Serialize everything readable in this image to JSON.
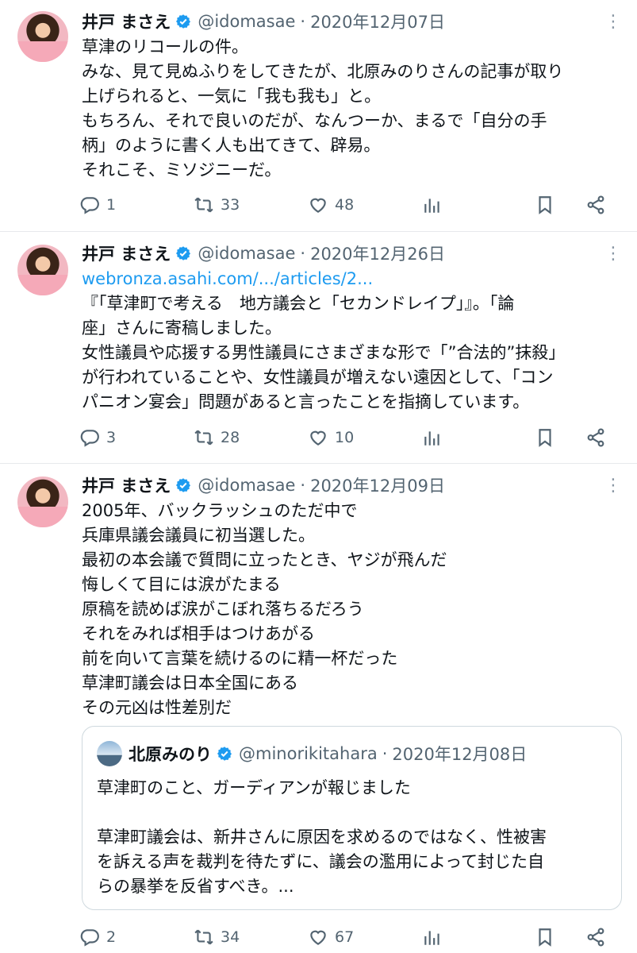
{
  "colors": {
    "accent": "#1d9bf0",
    "secondary_text": "#536471",
    "divider": "#e7e9ec"
  },
  "icons": [
    "reply-icon",
    "retweet-icon",
    "like-icon",
    "views-icon",
    "bookmark-icon",
    "share-icon",
    "verified-icon",
    "more-icon"
  ],
  "tweets": [
    {
      "name": "井戸 まさえ",
      "handle": "@idomasae",
      "separator": "·",
      "date": "2020年12月07日",
      "more": "⋮",
      "link": "",
      "lines": [
        "草津のリコールの件。",
        "みな、見て見ぬふりをしてきたが、北原みのりさんの記事が取り",
        "上げられると、一気に「我も我も」と。",
        "もちろん、それで良いのだが、なんつーか、まるで「自分の手",
        "柄」のように書く人も出てきて、辟易。",
        "それこそ、ミソジニーだ。"
      ],
      "replies": "1",
      "retweets": "33",
      "likes": "48"
    },
    {
      "name": "井戸 まさえ",
      "handle": "@idomasae",
      "separator": "·",
      "date": "2020年12月26日",
      "more": "⋮",
      "link": "webronza.asahi.com/.../articles/2...",
      "lines": [
        "『「草津町で考える　地方議会と「セカンドレイプ」』。「論",
        "座」さんに寄稿しました。",
        "女性議員や応援する男性議員にさまざまな形で「”合法的”抹殺」",
        "が行われていることや、女性議員が増えない遠因として、「コン",
        "パニオン宴会」問題があると言ったことを指摘しています。"
      ],
      "replies": "3",
      "retweets": "28",
      "likes": "10"
    },
    {
      "name": "井戸 まさえ",
      "handle": "@idomasae",
      "separator": "·",
      "date": "2020年12月09日",
      "more": "⋮",
      "link": "",
      "lines": [
        "2005年、バックラッシュのただ中で",
        "兵庫県議会議員に初当選した。",
        "最初の本会議で質問に立ったとき、ヤジが飛んだ",
        "悔しくて目には涙がたまる",
        "原稿を読めば涙がこぼれ落ちるだろう",
        "それをみれば相手はつけあがる",
        "前を向いて言葉を続けるのに精一杯だった",
        "草津町議会は日本全国にある",
        "その元凶は性差別だ"
      ],
      "replies": "2",
      "retweets": "34",
      "likes": "67",
      "quote": {
        "name": "北原みのり",
        "handle": "@minorikitahara",
        "separator": "·",
        "date": "2020年12月08日",
        "lines": [
          "草津町のこと、ガーディアンが報じました",
          "",
          "草津町議会は、新井さんに原因を求めるのではなく、性被害",
          "を訴える声を裁判を待たずに、議会の濫用によって封じた自",
          "らの暴挙を反省すべき。..."
        ]
      }
    }
  ]
}
